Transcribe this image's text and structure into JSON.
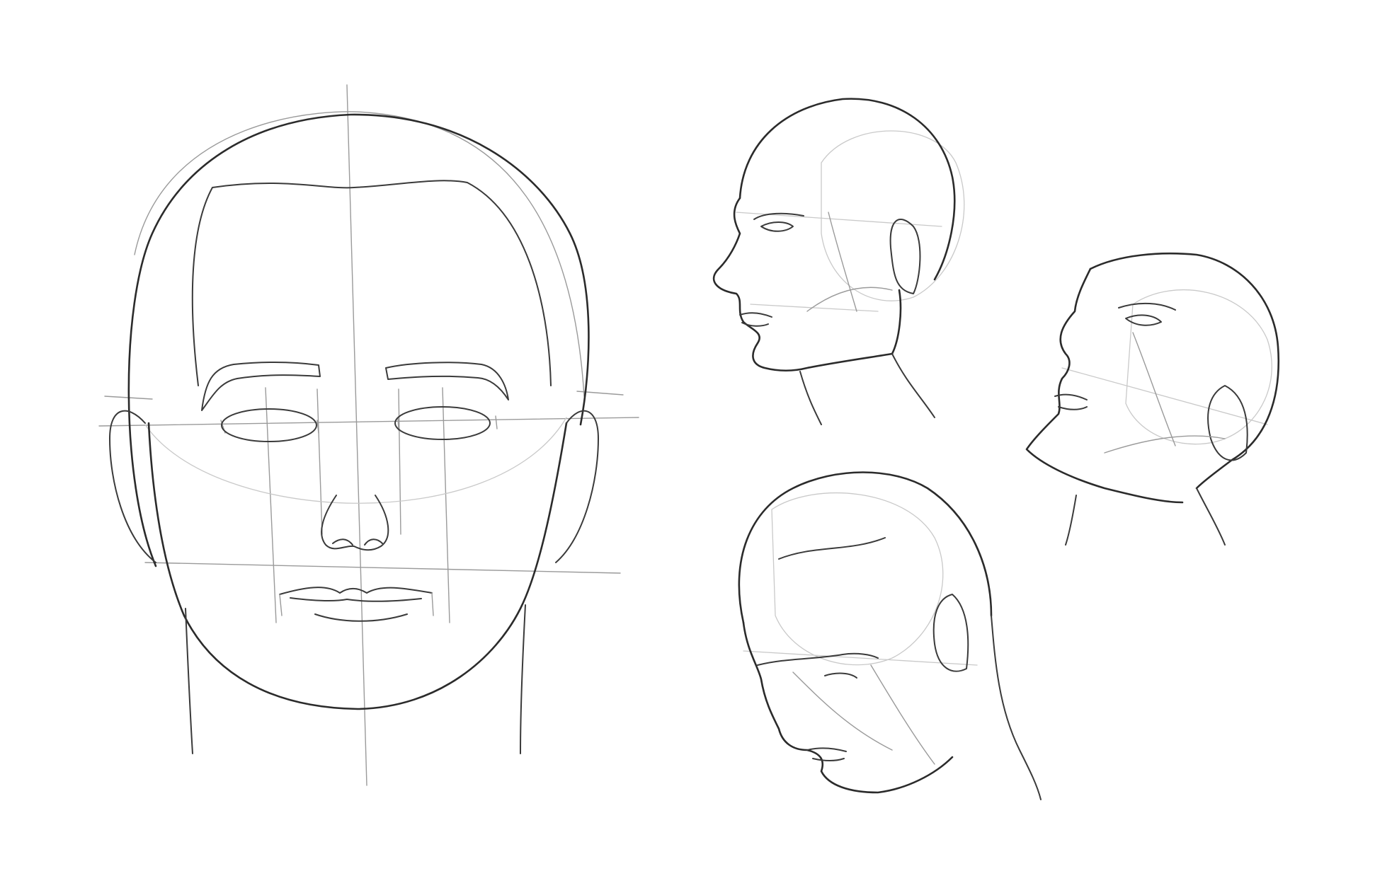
{
  "image": {
    "background": "#ffffff",
    "line_color": "#2b2b2b",
    "guide_color": "#9a9a9a"
  }
}
